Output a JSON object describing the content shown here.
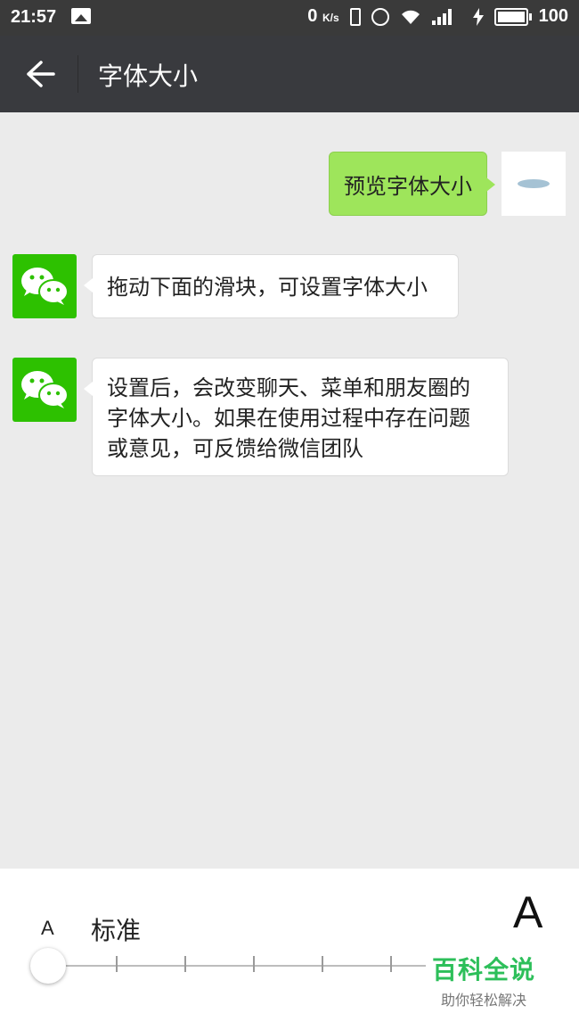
{
  "status_bar": {
    "time": "21:57",
    "net_speed": "0",
    "net_unit": "K/s",
    "battery_level": "100"
  },
  "titlebar": {
    "title": "字体大小"
  },
  "chat": {
    "messages": [
      {
        "side": "right",
        "text": "预览字体大小"
      },
      {
        "side": "left",
        "text": "拖动下面的滑块，可设置字体大小"
      },
      {
        "side": "left",
        "lines": [
          "设置后，会改变聊天、菜单和朋友圈的",
          "字体大小。如果在使用过程中存在问题",
          "或意见，可反馈给微信团队"
        ]
      }
    ]
  },
  "font_panel": {
    "small_a": "A",
    "large_a": "A",
    "current_label": "标准",
    "slider_steps": 7,
    "slider_position": 0
  },
  "watermark": {
    "title": "百科全说",
    "subtitle": "助你轻松解决"
  },
  "colors": {
    "bubble_green": "#9ee55b",
    "wechat_green": "#2dc100",
    "titlebar": "#393a3e"
  }
}
